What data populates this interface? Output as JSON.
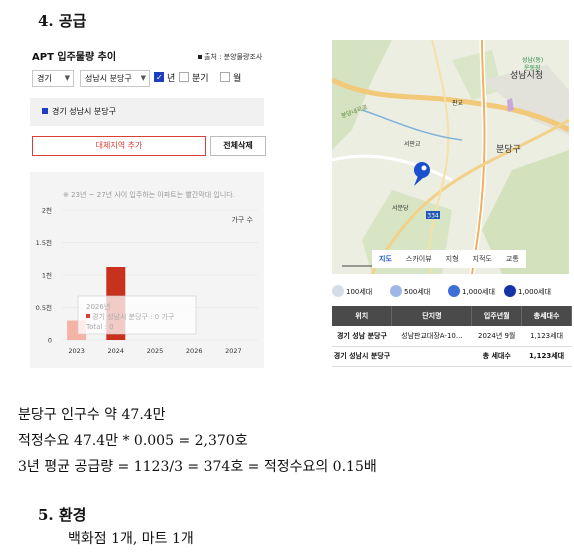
{
  "section4": {
    "title": "4. 공급"
  },
  "left_panel": {
    "title": "APT 입주물량 추이",
    "source": "출처 : 분양물량조사",
    "region_select": "경기",
    "district_select": "성남시 분당구",
    "options": [
      {
        "label": "년",
        "checked": true
      },
      {
        "label": "분기",
        "checked": false
      },
      {
        "label": "월",
        "checked": false
      }
    ],
    "selected_region": "경기 성남시 분당구",
    "add_region_button": "대체지역 추가",
    "delete_all_button": "전체삭제",
    "note": "※ 23년 ~ 27년 사이 입주하는 아파트는 빨간막대 입니다.",
    "tooltip": {
      "year": "2026년",
      "line1": "경기 성남시 분당구 : 0 가구",
      "line2": "Total : 0"
    }
  },
  "chart_data": {
    "type": "bar",
    "categories": [
      "2023",
      "2024",
      "2025",
      "2026",
      "2027"
    ],
    "values": [
      0.3,
      1.123,
      0,
      0,
      0
    ],
    "ylabel": "가구 수",
    "ylim": [
      0,
      2
    ],
    "y_ticks": [
      "0",
      "0.5천",
      "1천",
      "1.5천",
      "2천"
    ],
    "colors": {
      "bar_2023": "#f5b3a6",
      "bar_2024": "#c8311c"
    }
  },
  "map": {
    "labels": [
      "성남시청",
      "분당구",
      "서판교",
      "서분당",
      "판교",
      "성남(동)",
      "운동장",
      "분당내곡로"
    ],
    "tabs": [
      "지도",
      "스카이뷰",
      "지형",
      "지적도",
      "교통"
    ],
    "active_tab": "지도",
    "road_sign": "334"
  },
  "legend": [
    "100세대",
    "500세대",
    "1,000세대",
    "1,000세대"
  ],
  "table": {
    "headers": [
      "위치",
      "단지명",
      "입주년월",
      "총세대수"
    ],
    "rows": [
      [
        "경기 성남 분당구",
        "성남판교대장A-10...",
        "2024년 9월",
        "1,123세대"
      ],
      [
        "경기 성남시 분당구",
        "",
        "총 세대수",
        "1,123세대"
      ]
    ]
  },
  "paragraphs": [
    "분당구 인구수 약 47.4만",
    "적정수요 47.4만 * 0.005 = 2,370호",
    "3년 평균 공급량 = 1123/3 = 374호 = 적정수요의 0.15배"
  ],
  "section5": {
    "title": "5. 환경",
    "content": "백화점 1개, 마트 1개"
  }
}
